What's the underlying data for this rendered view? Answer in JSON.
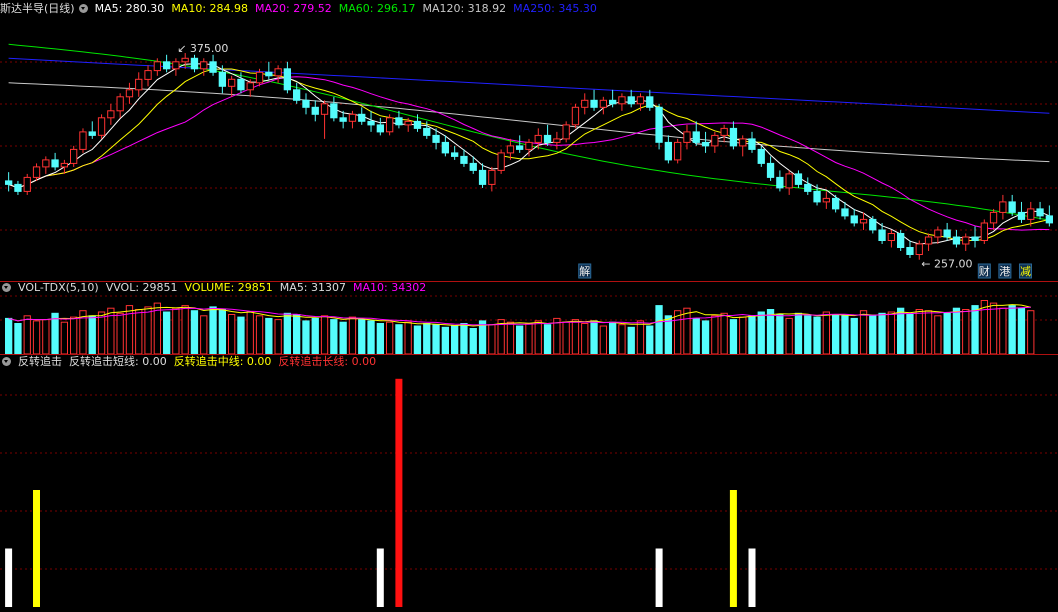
{
  "colors": {
    "up": "#ff3232",
    "down": "#54fcfc",
    "ma5": "#ffffff",
    "ma10": "#ffff00",
    "ma20": "#ff00ff",
    "ma60": "#00e600",
    "ma120": "#c8c8c8",
    "ma250": "#2020ff",
    "grid": "#7a0000",
    "text_red": "#ff3232",
    "text_yellow": "#ffff00"
  },
  "price_panel": {
    "title": "斯达半导(日线)",
    "ma5": "MA5: 280.30",
    "ma10": "MA10: 284.98",
    "ma20": "MA20: 279.52",
    "ma60": "MA60: 296.17",
    "ma120": "MA120: 318.92",
    "ma250": "MA250: 345.30",
    "high_label": "375.00",
    "low_label": "257.00",
    "markers": [
      "解",
      "财",
      "港",
      "减"
    ]
  },
  "volume_panel": {
    "title": "VOL-TDX(5,10)",
    "vvol": "VVOL: 29851",
    "volume": "VOLUME: 29851",
    "ma5": "MA5: 31307",
    "ma10": "MA10: 34302"
  },
  "indicator_panel": {
    "title": "反转追击",
    "short": "反转追击短线: 0.00",
    "mid": "反转追击中线: 0.00",
    "long": "反转追击长线: 0.00"
  },
  "chart_data": {
    "type": "candlestick",
    "ylim": [
      250,
      395
    ],
    "ohlc": [
      [
        302,
        307,
        296,
        300
      ],
      [
        300,
        302,
        294,
        296
      ],
      [
        296,
        306,
        294,
        304
      ],
      [
        304,
        312,
        302,
        310
      ],
      [
        310,
        316,
        306,
        314
      ],
      [
        314,
        318,
        308,
        310
      ],
      [
        310,
        314,
        306,
        312
      ],
      [
        312,
        322,
        310,
        320
      ],
      [
        320,
        332,
        318,
        330
      ],
      [
        330,
        336,
        326,
        328
      ],
      [
        328,
        340,
        326,
        338
      ],
      [
        338,
        346,
        334,
        342
      ],
      [
        342,
        352,
        338,
        350
      ],
      [
        350,
        358,
        346,
        354
      ],
      [
        354,
        364,
        350,
        360
      ],
      [
        360,
        368,
        356,
        365
      ],
      [
        365,
        372,
        362,
        370
      ],
      [
        370,
        374,
        364,
        366
      ],
      [
        366,
        372,
        362,
        370
      ],
      [
        370,
        375,
        366,
        372
      ],
      [
        372,
        374,
        364,
        366
      ],
      [
        366,
        372,
        362,
        370
      ],
      [
        370,
        374,
        362,
        364
      ],
      [
        364,
        368,
        352,
        356
      ],
      [
        356,
        362,
        350,
        360
      ],
      [
        360,
        364,
        352,
        354
      ],
      [
        354,
        360,
        350,
        358
      ],
      [
        358,
        366,
        356,
        364
      ],
      [
        364,
        370,
        360,
        362
      ],
      [
        362,
        368,
        358,
        366
      ],
      [
        366,
        370,
        352,
        354
      ],
      [
        354,
        358,
        346,
        348
      ],
      [
        348,
        352,
        340,
        344
      ],
      [
        344,
        348,
        336,
        340
      ],
      [
        340,
        348,
        326,
        346
      ],
      [
        346,
        350,
        336,
        338
      ],
      [
        338,
        342,
        332,
        336
      ],
      [
        336,
        342,
        332,
        340
      ],
      [
        340,
        344,
        334,
        336
      ],
      [
        336,
        342,
        330,
        334
      ],
      [
        334,
        338,
        328,
        330
      ],
      [
        330,
        340,
        328,
        338
      ],
      [
        338,
        342,
        332,
        334
      ],
      [
        334,
        338,
        330,
        336
      ],
      [
        336,
        340,
        330,
        332
      ],
      [
        332,
        336,
        326,
        328
      ],
      [
        328,
        332,
        320,
        324
      ],
      [
        324,
        328,
        316,
        318
      ],
      [
        318,
        322,
        314,
        316
      ],
      [
        316,
        320,
        310,
        312
      ],
      [
        312,
        316,
        306,
        308
      ],
      [
        308,
        312,
        298,
        300
      ],
      [
        300,
        310,
        296,
        308
      ],
      [
        308,
        320,
        306,
        318
      ],
      [
        318,
        326,
        314,
        322
      ],
      [
        322,
        328,
        318,
        320
      ],
      [
        320,
        326,
        316,
        324
      ],
      [
        324,
        332,
        320,
        328
      ],
      [
        328,
        334,
        322,
        324
      ],
      [
        324,
        330,
        320,
        326
      ],
      [
        326,
        336,
        324,
        334
      ],
      [
        334,
        346,
        332,
        344
      ],
      [
        344,
        352,
        340,
        348
      ],
      [
        348,
        354,
        342,
        344
      ],
      [
        344,
        350,
        340,
        348
      ],
      [
        348,
        354,
        344,
        346
      ],
      [
        346,
        352,
        342,
        350
      ],
      [
        350,
        354,
        344,
        346
      ],
      [
        346,
        352,
        342,
        350
      ],
      [
        350,
        354,
        342,
        344
      ],
      [
        344,
        346,
        320,
        324
      ],
      [
        324,
        328,
        312,
        314
      ],
      [
        314,
        326,
        312,
        324
      ],
      [
        324,
        334,
        320,
        330
      ],
      [
        330,
        336,
        322,
        324
      ],
      [
        324,
        330,
        318,
        322
      ],
      [
        322,
        330,
        318,
        328
      ],
      [
        328,
        334,
        324,
        332
      ],
      [
        332,
        336,
        320,
        322
      ],
      [
        322,
        328,
        316,
        326
      ],
      [
        326,
        330,
        318,
        320
      ],
      [
        320,
        322,
        310,
        312
      ],
      [
        312,
        316,
        302,
        304
      ],
      [
        304,
        308,
        296,
        298
      ],
      [
        298,
        308,
        294,
        306
      ],
      [
        306,
        308,
        298,
        300
      ],
      [
        300,
        304,
        294,
        296
      ],
      [
        296,
        300,
        288,
        290
      ],
      [
        290,
        296,
        286,
        292
      ],
      [
        292,
        294,
        284,
        286
      ],
      [
        286,
        290,
        280,
        282
      ],
      [
        282,
        286,
        276,
        278
      ],
      [
        278,
        284,
        274,
        280
      ],
      [
        280,
        282,
        272,
        274
      ],
      [
        274,
        278,
        266,
        268
      ],
      [
        268,
        274,
        264,
        272
      ],
      [
        272,
        274,
        262,
        264
      ],
      [
        264,
        268,
        258,
        260
      ],
      [
        260,
        268,
        257,
        266
      ],
      [
        266,
        272,
        262,
        270
      ],
      [
        270,
        276,
        266,
        274
      ],
      [
        274,
        278,
        268,
        270
      ],
      [
        270,
        274,
        264,
        266
      ],
      [
        266,
        272,
        262,
        270
      ],
      [
        270,
        276,
        264,
        268
      ],
      [
        268,
        280,
        266,
        278
      ],
      [
        278,
        286,
        274,
        284
      ],
      [
        284,
        294,
        280,
        290
      ],
      [
        290,
        294,
        282,
        284
      ],
      [
        284,
        290,
        278,
        280
      ],
      [
        280,
        290,
        276,
        286
      ],
      [
        286,
        290,
        280,
        282
      ],
      [
        282,
        288,
        276,
        278
      ]
    ]
  },
  "volume_data": [
    28,
    24,
    30,
    26,
    27,
    32,
    25,
    29,
    34,
    30,
    33,
    36,
    32,
    38,
    35,
    37,
    40,
    33,
    36,
    38,
    34,
    30,
    37,
    35,
    31,
    29,
    33,
    30,
    28,
    27,
    32,
    31,
    26,
    28,
    30,
    27,
    25,
    29,
    27,
    26,
    24,
    25,
    23,
    25,
    22,
    24,
    23,
    21,
    22,
    24,
    20,
    26,
    23,
    27,
    25,
    22,
    24,
    26,
    23,
    28,
    25,
    27,
    24,
    26,
    22,
    25,
    23,
    21,
    26,
    22,
    38,
    30,
    34,
    36,
    28,
    26,
    30,
    32,
    27,
    29,
    30,
    33,
    35,
    31,
    28,
    32,
    30,
    29,
    33,
    31,
    30,
    28,
    34,
    30,
    32,
    33,
    36,
    31,
    35,
    34,
    30,
    32,
    36,
    35,
    38,
    42,
    40,
    36,
    38,
    36,
    34
  ],
  "indicator_data": {
    "ylim": [
      0,
      4
    ],
    "white_bars": [
      0,
      40,
      70,
      80
    ],
    "yellow_bars": [
      3,
      78
    ],
    "red_bars": [
      42
    ]
  }
}
